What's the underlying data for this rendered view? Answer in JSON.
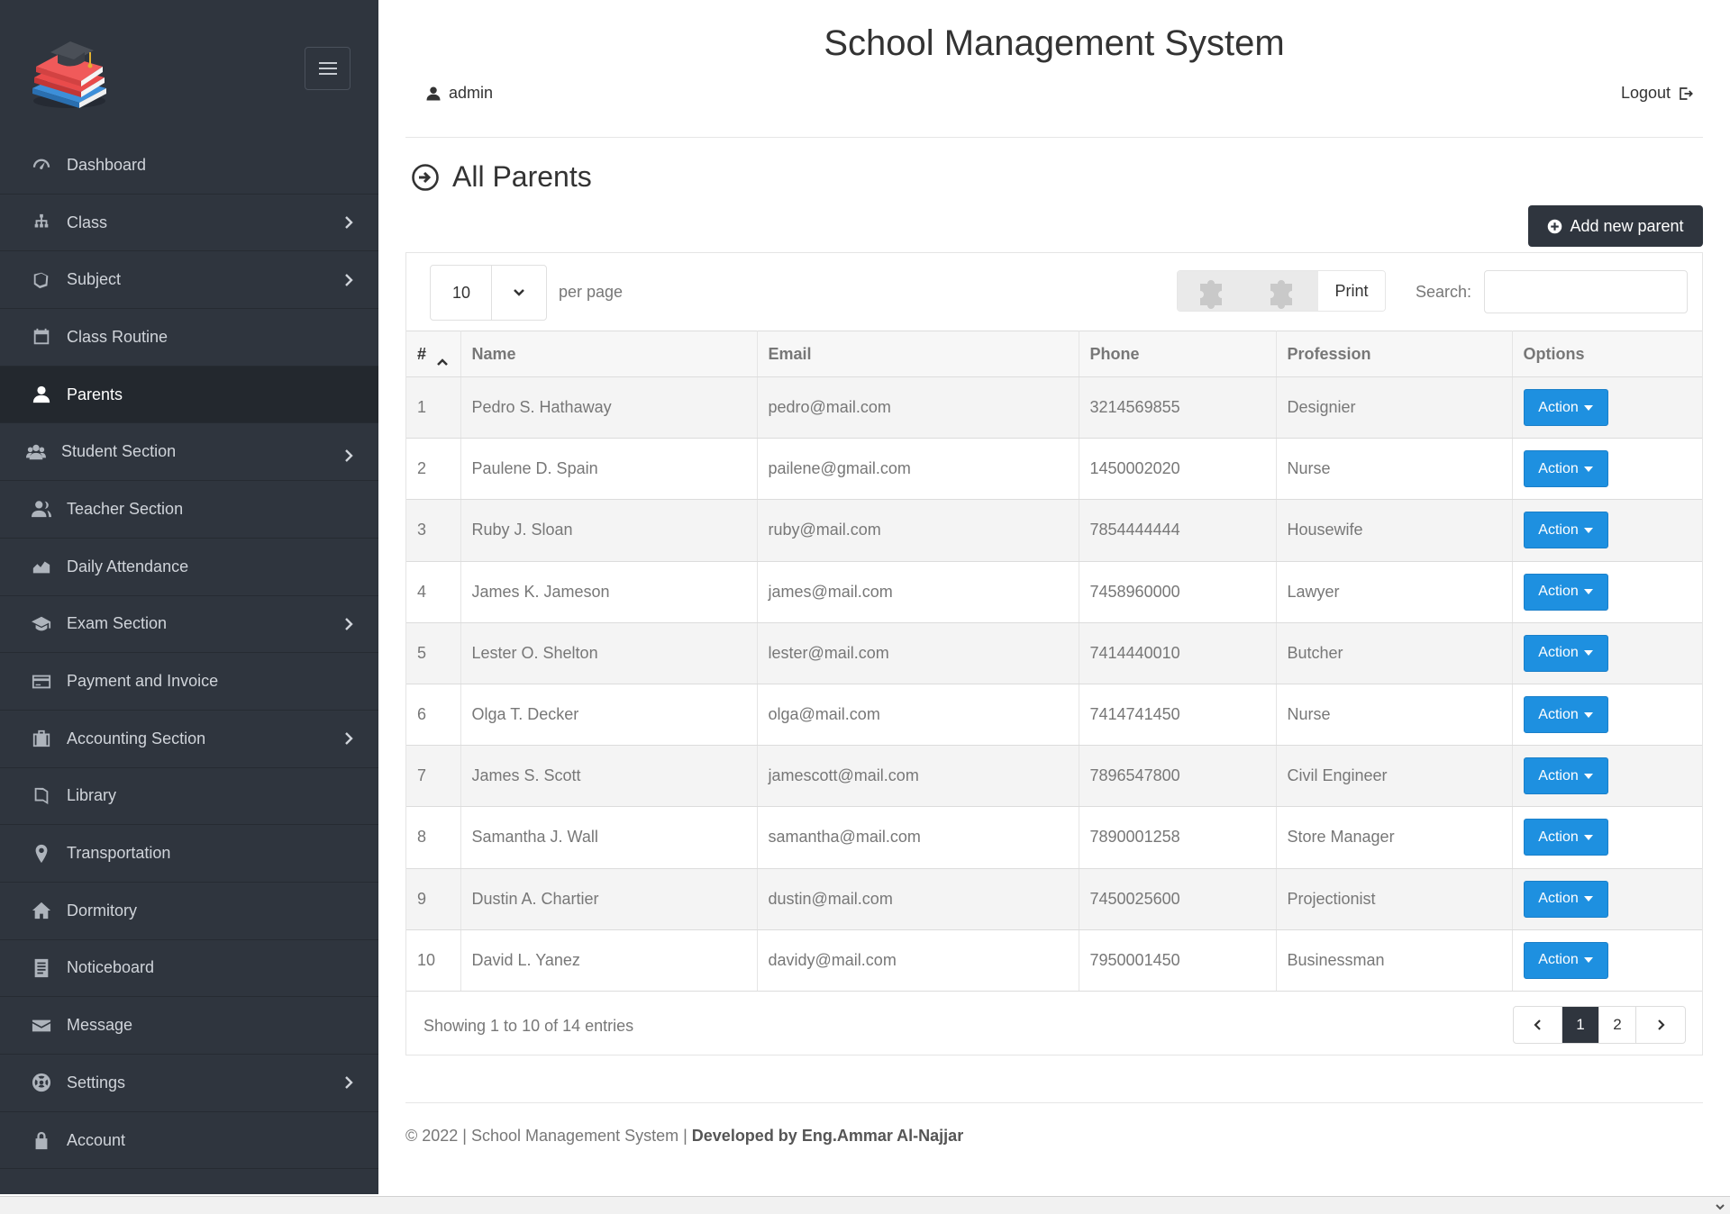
{
  "app": {
    "title": "School Management System"
  },
  "header": {
    "user": "admin",
    "logout": "Logout"
  },
  "sidebar": {
    "items": [
      {
        "label": "Dashboard",
        "icon": "dashboard-gauge-icon",
        "chevron": false,
        "active": false
      },
      {
        "label": "Class",
        "icon": "sitemap-icon",
        "chevron": true,
        "active": false
      },
      {
        "label": "Subject",
        "icon": "book-tag-icon",
        "chevron": true,
        "active": false
      },
      {
        "label": "Class Routine",
        "icon": "calendar-icon",
        "chevron": false,
        "active": false
      },
      {
        "label": "Parents",
        "icon": "user-icon",
        "chevron": false,
        "active": true
      },
      {
        "label": "Student Section",
        "icon": "users-icon",
        "chevron": true,
        "active": false
      },
      {
        "label": "Teacher Section",
        "icon": "user-tie-icon",
        "chevron": false,
        "active": false
      },
      {
        "label": "Daily Attendance",
        "icon": "area-chart-icon",
        "chevron": false,
        "active": false
      },
      {
        "label": "Exam Section",
        "icon": "graduation-cap-icon",
        "chevron": true,
        "active": false
      },
      {
        "label": "Payment and Invoice",
        "icon": "credit-card-icon",
        "chevron": false,
        "active": false
      },
      {
        "label": "Accounting Section",
        "icon": "briefcase-icon",
        "chevron": true,
        "active": false
      },
      {
        "label": "Library",
        "icon": "book-icon",
        "chevron": false,
        "active": false
      },
      {
        "label": "Transportation",
        "icon": "map-marker-icon",
        "chevron": false,
        "active": false
      },
      {
        "label": "Dormitory",
        "icon": "home-icon",
        "chevron": false,
        "active": false
      },
      {
        "label": "Noticeboard",
        "icon": "notice-list-icon",
        "chevron": false,
        "active": false
      },
      {
        "label": "Message",
        "icon": "envelope-icon",
        "chevron": false,
        "active": false
      },
      {
        "label": "Settings",
        "icon": "lifebuoy-icon",
        "chevron": true,
        "active": false
      },
      {
        "label": "Account",
        "icon": "lock-icon",
        "chevron": false,
        "active": false
      }
    ]
  },
  "page": {
    "title": "All Parents",
    "add_button": "Add new parent",
    "per_page_value": "10",
    "per_page_label": "per page",
    "print_label": "Print",
    "search_label": "Search:",
    "search_placeholder": "",
    "columns": [
      "#",
      "Name",
      "Email",
      "Phone",
      "Profession",
      "Options"
    ],
    "rows": [
      {
        "num": "1",
        "name": "Pedro S. Hathaway",
        "email": "pedro@mail.com",
        "phone": "3214569855",
        "profession": "Designier",
        "action": "Action"
      },
      {
        "num": "2",
        "name": "Paulene D. Spain",
        "email": "pailene@gmail.com",
        "phone": "1450002020",
        "profession": "Nurse",
        "action": "Action"
      },
      {
        "num": "3",
        "name": "Ruby J. Sloan",
        "email": "ruby@mail.com",
        "phone": "7854444444",
        "profession": "Housewife",
        "action": "Action"
      },
      {
        "num": "4",
        "name": "James K. Jameson",
        "email": "james@mail.com",
        "phone": "7458960000",
        "profession": "Lawyer",
        "action": "Action"
      },
      {
        "num": "5",
        "name": "Lester O. Shelton",
        "email": "lester@mail.com",
        "phone": "7414440010",
        "profession": "Butcher",
        "action": "Action"
      },
      {
        "num": "6",
        "name": "Olga T. Decker",
        "email": "olga@mail.com",
        "phone": "7414741450",
        "profession": "Nurse",
        "action": "Action"
      },
      {
        "num": "7",
        "name": "James S. Scott",
        "email": "jamescott@mail.com",
        "phone": "7896547800",
        "profession": "Civil Engineer",
        "action": "Action"
      },
      {
        "num": "8",
        "name": "Samantha J. Wall",
        "email": "samantha@mail.com",
        "phone": "7890001258",
        "profession": "Store Manager",
        "action": "Action"
      },
      {
        "num": "9",
        "name": "Dustin A. Chartier",
        "email": "dustin@mail.com",
        "phone": "7450025600",
        "profession": "Projectionist",
        "action": "Action"
      },
      {
        "num": "10",
        "name": "David L. Yanez",
        "email": "davidy@mail.com",
        "phone": "7950001450",
        "profession": "Businessman",
        "action": "Action"
      }
    ],
    "showing": "Showing 1 to 10 of 14 entries",
    "pagination": {
      "pages": [
        "1",
        "2"
      ],
      "current": "1"
    }
  },
  "footer": {
    "text": "© 2022 | School Management System | ",
    "credit": "Developed by Eng.Ammar Al-Najjar"
  },
  "colors": {
    "sidebar": "#2f353e",
    "sidebar_active": "#23282e",
    "action": "#1e90e0",
    "dark_button": "#2f353e"
  }
}
